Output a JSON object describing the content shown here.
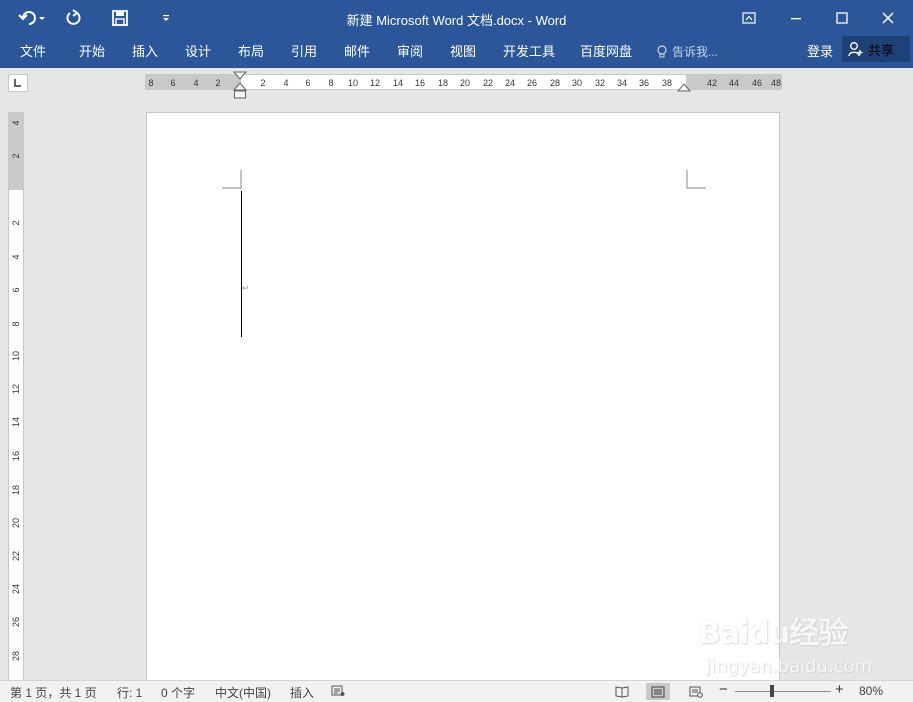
{
  "window": {
    "title": "新建 Microsoft Word 文档.docx - Word"
  },
  "quick_access": {
    "icons": [
      "undo-icon",
      "redo-icon",
      "save-icon",
      "customize-icon"
    ]
  },
  "ribbon": {
    "tabs": [
      "文件",
      "开始",
      "插入",
      "设计",
      "布局",
      "引用",
      "邮件",
      "审阅",
      "视图",
      "开发工具",
      "百度网盘"
    ],
    "tell_me": "告诉我...",
    "sign_in": "登录",
    "share": "共享"
  },
  "ruler": {
    "horizontal_left_labels": [
      "8",
      "6",
      "4",
      "2"
    ],
    "horizontal_labels": [
      "2",
      "4",
      "6",
      "8",
      "10",
      "12",
      "14",
      "16",
      "18",
      "20",
      "22",
      "24",
      "26",
      "28",
      "30",
      "32",
      "34",
      "36",
      "38"
    ],
    "horizontal_right_labels": [
      "42",
      "44",
      "46",
      "48"
    ],
    "vertical_top_labels": [
      "4",
      "2"
    ],
    "vertical_labels": [
      "2",
      "4",
      "6",
      "8",
      "10",
      "12",
      "14",
      "16",
      "18",
      "20",
      "22",
      "24",
      "26",
      "28"
    ]
  },
  "watermark": {
    "brand": "Baidu经验",
    "site": "jingyan.baidu.com"
  },
  "status": {
    "page": "第 1 页，共 1 页",
    "line": "行: 1",
    "words": "0 个字",
    "language": "中文(中国)",
    "mode": "插入",
    "zoom": "80%"
  },
  "colors": {
    "accent": "#2b579a",
    "share_bg": "#1e4276",
    "status_bg": "#f1f1f1"
  }
}
